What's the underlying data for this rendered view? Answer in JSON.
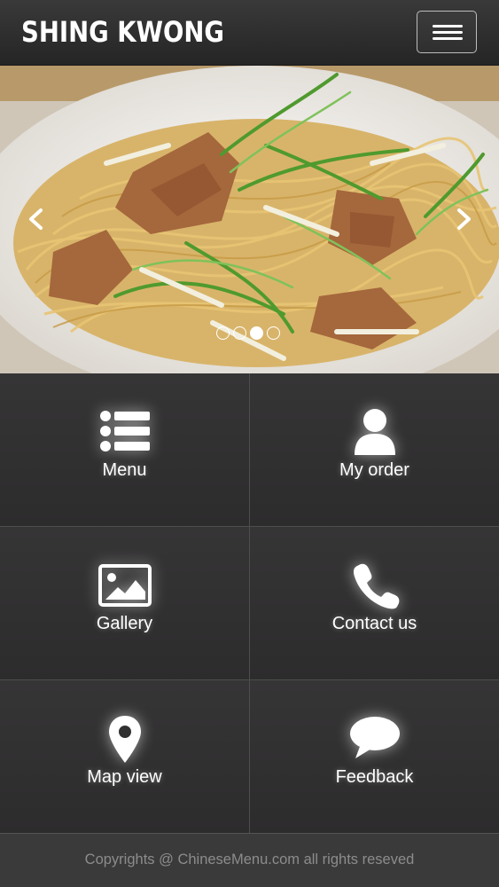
{
  "header": {
    "brand": "SHING KWONG",
    "menu_toggle_icon": "hamburger-icon"
  },
  "carousel": {
    "image_subject": "noodles-with-beef-and-scallions",
    "slide_count": 4,
    "active_slide": 3,
    "prev_icon": "chevron-left-icon",
    "next_icon": "chevron-right-icon"
  },
  "tiles": [
    {
      "label": "Menu",
      "icon": "list-icon"
    },
    {
      "label": "My order",
      "icon": "user-icon"
    },
    {
      "label": "Gallery",
      "icon": "image-icon"
    },
    {
      "label": "Contact us",
      "icon": "phone-icon"
    },
    {
      "label": "Map view",
      "icon": "map-marker-icon"
    },
    {
      "label": "Feedback",
      "icon": "speech-bubble-icon"
    }
  ],
  "footer": {
    "text": "Copyrights @ ChineseMenu.com all rights reseved"
  },
  "colors": {
    "background": "#2b2a2b",
    "header": "#2f2e2f",
    "footer": "#3b3a3b",
    "footer_text": "#8d8c8d",
    "text": "#ffffff"
  }
}
